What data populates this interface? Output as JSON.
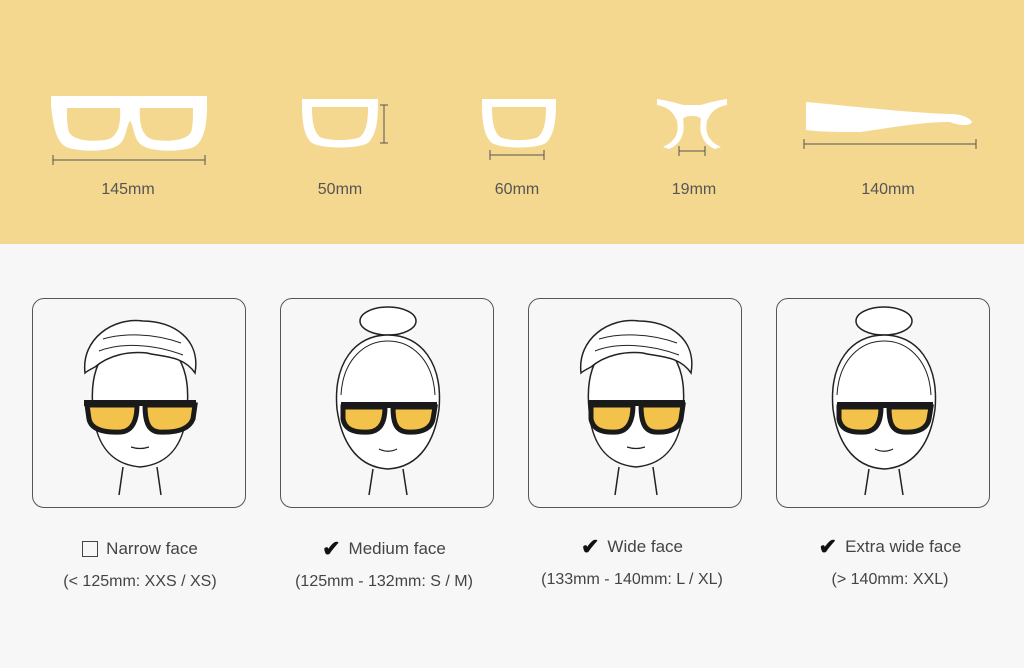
{
  "dimensions": [
    {
      "name": "frame-width",
      "value": "145mm"
    },
    {
      "name": "lens-height",
      "value": "50mm"
    },
    {
      "name": "lens-width",
      "value": "60mm"
    },
    {
      "name": "bridge-width",
      "value": "19mm"
    },
    {
      "name": "temple-length",
      "value": "140mm"
    }
  ],
  "faces": [
    {
      "label": "Narrow face",
      "range": "(< 125mm: XXS / XS)",
      "checked": false,
      "icon": "male-face-icon"
    },
    {
      "label": "Medium face",
      "range": "(125mm - 132mm: S / M)",
      "checked": true,
      "icon": "female-face-icon"
    },
    {
      "label": "Wide face",
      "range": "(133mm - 140mm: L / XL)",
      "checked": true,
      "icon": "male-face-icon"
    },
    {
      "label": "Extra wide face",
      "range": "(> 140mm: XXL)",
      "checked": true,
      "icon": "female-face-icon"
    }
  ],
  "symbols": {
    "check": "✔"
  },
  "colors": {
    "top_background": "#f5d890",
    "lens": "#f2c24a",
    "frame": "#1a1a1a",
    "page_background": "#f7f7f7"
  }
}
